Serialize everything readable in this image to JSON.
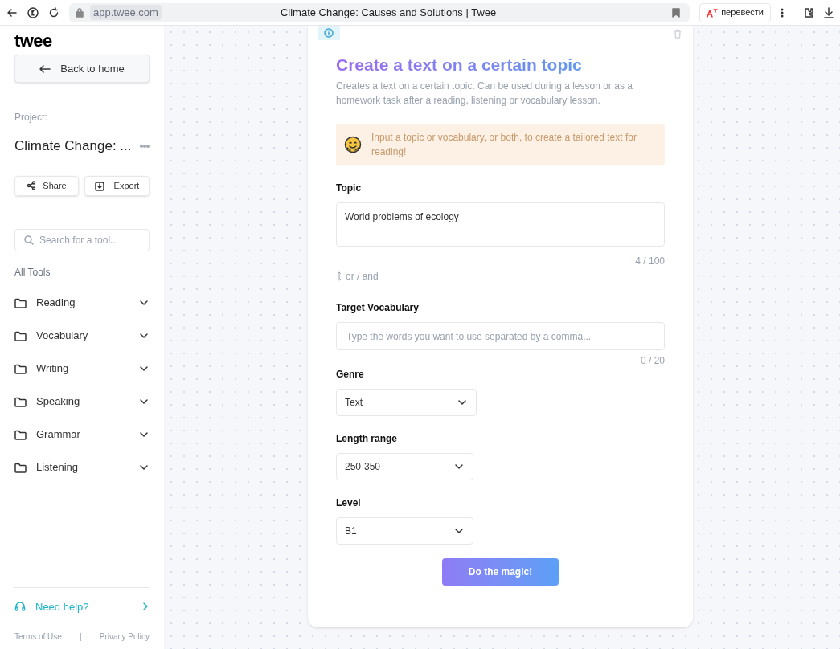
{
  "browser": {
    "url": "app.twee.com",
    "title": "Climate Change: Causes and Solutions | Twee",
    "translate_label": "перевести"
  },
  "sidebar": {
    "logo": "twee",
    "back_button": "Back to home",
    "project_label": "Project:",
    "project_name": "Climate Change: ...",
    "share": "Share",
    "export": "Export",
    "search_placeholder": "Search for a tool...",
    "tools_heading": "All Tools",
    "tools": [
      {
        "label": "Reading",
        "expanded": false
      },
      {
        "label": "Vocabulary",
        "expanded": false
      },
      {
        "label": "Writing",
        "expanded": false
      },
      {
        "label": "Speaking",
        "expanded": false
      },
      {
        "label": "Grammar",
        "expanded": false
      },
      {
        "label": "Listening",
        "expanded": false
      }
    ],
    "help": "Need help?",
    "footer_links": [
      "Terms of Use",
      "Privacy Policy"
    ],
    "footer_separator": "|"
  },
  "card": {
    "title": "Create a text on a certain topic",
    "description": "Creates a text on a certain topic. Can be used during a lesson or as a homework task after a reading, listening or vocabulary lesson.",
    "tip": "Input a topic or vocabulary, or both, to create a tailored text for reading!",
    "topic": {
      "label": "Topic",
      "value": "World problems of ecology",
      "counter": "4 / 100"
    },
    "or_and": "or / and",
    "vocabulary": {
      "label": "Target Vocabulary",
      "placeholder": "Type the words you want to use separated by a comma...",
      "counter": "0 / 20"
    },
    "selects": [
      {
        "label": "Genre",
        "value": "Text"
      },
      {
        "label": "Length range",
        "value": "250-350"
      },
      {
        "label": "Level",
        "value": "B1"
      }
    ],
    "button": "Do the magic!"
  }
}
